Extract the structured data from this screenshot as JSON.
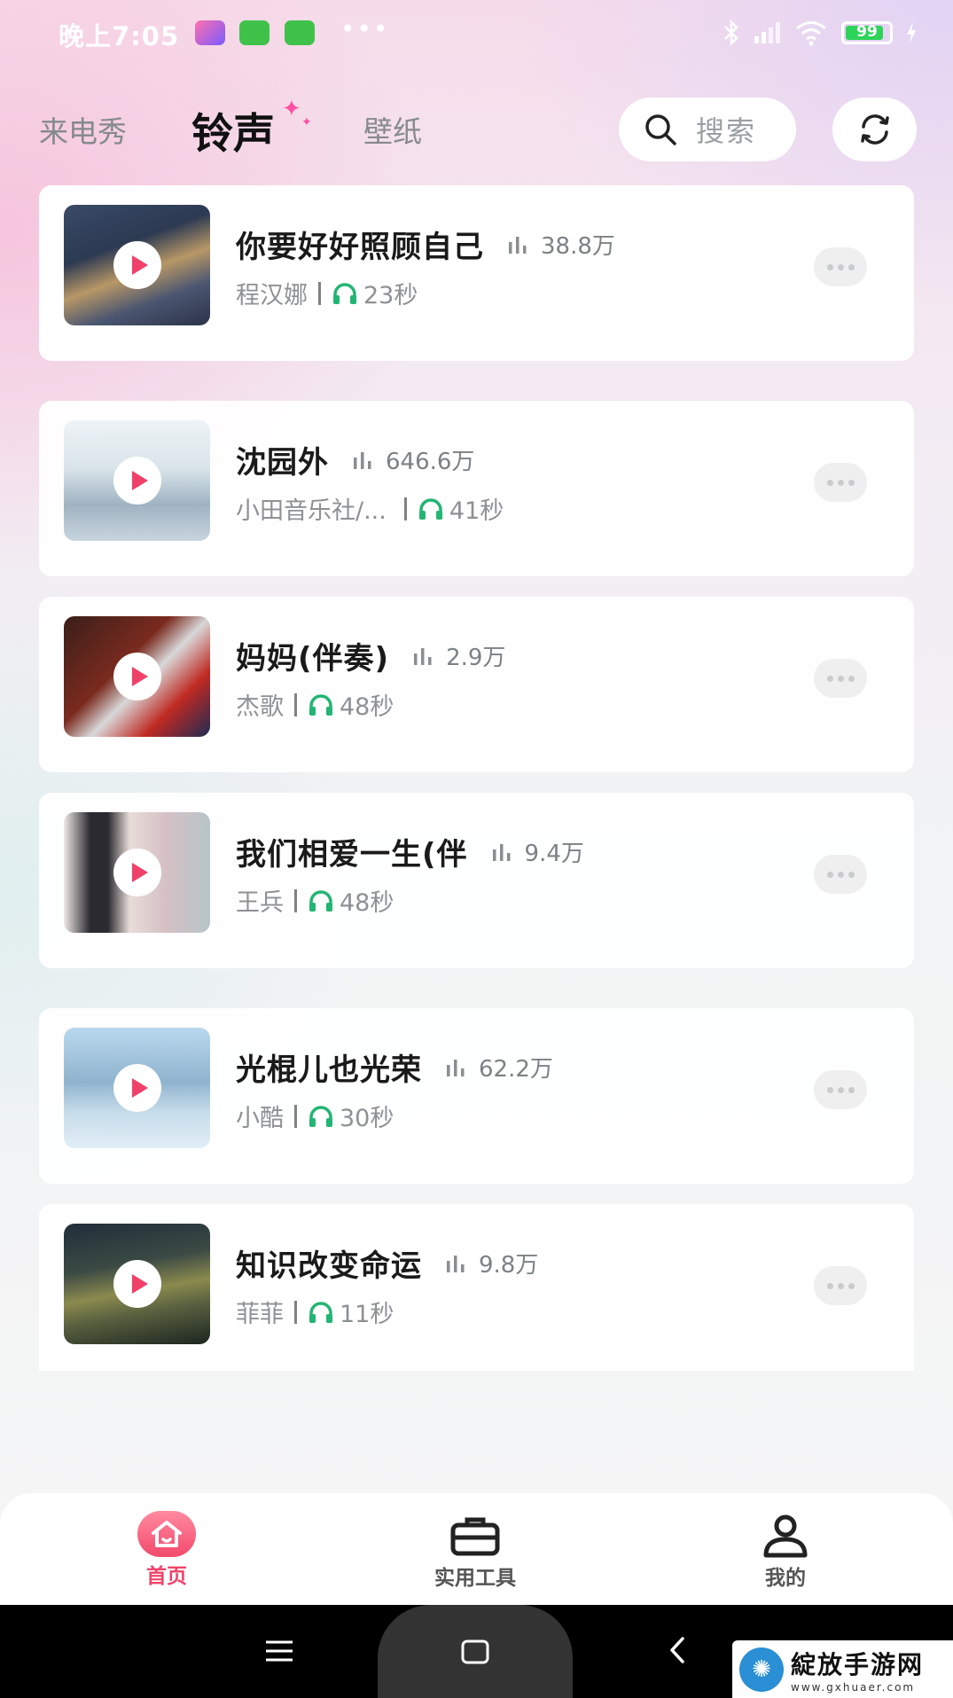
{
  "status_bar": {
    "time": "晚上7:05",
    "battery": "99"
  },
  "header": {
    "tabs": [
      {
        "label": "来电秀"
      },
      {
        "label": "铃声"
      },
      {
        "label": "壁纸"
      }
    ],
    "active_tab": "铃声",
    "search_placeholder": "搜索"
  },
  "ringtones": [
    {
      "title": "你要好好照顾自己",
      "plays": "38.8万",
      "artist": "程汉娜",
      "duration": "23秒"
    },
    {
      "title": "沈园外",
      "plays": "646.6万",
      "artist": "小田音乐社/...",
      "duration": "41秒"
    },
    {
      "title": "妈妈(伴奏)",
      "plays": "2.9万",
      "artist": "杰歌",
      "duration": "48秒"
    },
    {
      "title": "我们相爱一生(伴",
      "plays": "9.4万",
      "artist": "王兵",
      "duration": "48秒"
    },
    {
      "title": "光棍儿也光荣",
      "plays": "62.2万",
      "artist": "小酷",
      "duration": "30秒"
    },
    {
      "title": "知识改变命运",
      "plays": "9.8万",
      "artist": "菲菲",
      "duration": "11秒"
    }
  ],
  "bottom_nav": [
    {
      "label": "首页",
      "icon": "home-icon",
      "active": true
    },
    {
      "label": "实用工具",
      "icon": "toolbox-icon",
      "active": false
    },
    {
      "label": "我的",
      "icon": "person-icon",
      "active": false
    }
  ],
  "watermark": {
    "name": "綻放手游网",
    "url": "www.gxhuaer.com"
  },
  "colors": {
    "accent": "#f0446a",
    "headphone_green": "#22b573"
  }
}
